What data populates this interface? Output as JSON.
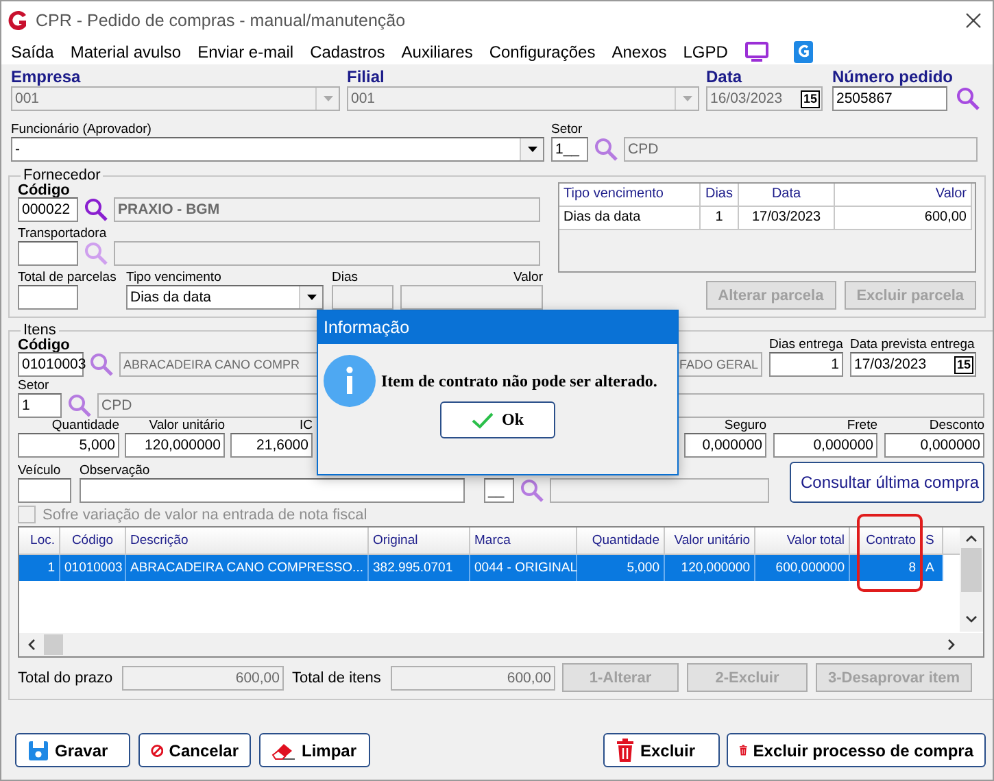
{
  "window": {
    "title": "CPR - Pedido de compras - manual/manutenção"
  },
  "menu": [
    {
      "label": "Saída"
    },
    {
      "label": "Material avulso"
    },
    {
      "label": "Enviar e-mail"
    },
    {
      "label": "Cadastros"
    },
    {
      "label": "Auxiliares"
    },
    {
      "label": "Configurações"
    },
    {
      "label": "Anexos"
    },
    {
      "label": "LGPD"
    }
  ],
  "header": {
    "empresa": {
      "label": "Empresa",
      "value": "001"
    },
    "filial": {
      "label": "Filial",
      "value": "001"
    },
    "data": {
      "label": "Data",
      "value": "16/03/2023",
      "calendar_day": "15"
    },
    "numero_pedido": {
      "label": "Número pedido",
      "value": "2505867"
    },
    "funcionario": {
      "label": "Funcionário (Aprovador)",
      "value": "-"
    },
    "setor": {
      "label": "Setor",
      "code": "1__",
      "name": "CPD"
    }
  },
  "fornecedor": {
    "title": "Fornecedor",
    "codigo_label": "Código",
    "codigo": "000022",
    "nome": "PRAXIO - BGM",
    "transportadora_label": "Transportadora",
    "total_parcelas_label": "Total de parcelas",
    "tipo_vencimento_label": "Tipo vencimento",
    "tipo_vencimento": "Dias da data",
    "dias_label": "Dias",
    "valor_label": "Valor",
    "parcelas": {
      "columns": [
        "Tipo vencimento",
        "Dias",
        "Data",
        "Valor"
      ],
      "rows": [
        [
          "Dias da data",
          "1",
          "17/03/2023",
          "600,00"
        ]
      ]
    },
    "buttons": [
      {
        "label": "Alterar parcela",
        "disabled": true
      },
      {
        "label": "Excluir parcela",
        "disabled": true
      }
    ]
  },
  "itens": {
    "title": "Itens",
    "codigo_label": "Código",
    "codigo": "01010003",
    "descricao_start": "ABRACADEIRA CANO COMPR",
    "descricao_end": "FADO GERAL",
    "dias_entrega_label": "Dias entrega",
    "dias_entrega": "1",
    "data_prevista_label": "Data prevista entrega",
    "data_prevista": "17/03/2023",
    "calendar_day": "15",
    "setor_label": "Setor",
    "setor": "1",
    "setor_nome": "CPD",
    "valores_left": [
      {
        "label": "Quantidade",
        "value": "5,000"
      },
      {
        "label": "Valor unitário",
        "value": "120,000000"
      },
      {
        "label": "IC",
        "value": "21,6000"
      }
    ],
    "valores_right": [
      {
        "label": "Seguro",
        "value": "0,000000"
      },
      {
        "label": "Frete",
        "value": "0,000000"
      },
      {
        "label": "Desconto",
        "value": "0,000000"
      }
    ],
    "veiculo_label": "Veículo",
    "observacao_label": "Observação",
    "mask_field": "__",
    "consultar_button": "Consultar última compra",
    "checkbox": {
      "label": "Sofre variação de valor na entrada de nota fiscal",
      "checked": false,
      "disabled": true
    },
    "table": {
      "columns": [
        "Loc.",
        "Código",
        "Descrição",
        "Original",
        "Marca",
        "Quantidade",
        "Valor unitário",
        "Valor total",
        "Contrato",
        "S"
      ],
      "rows": [
        {
          "selected": true,
          "cells": [
            "1",
            "01010003",
            "ABRACADEIRA CANO COMPRESSO...",
            "382.995.0701",
            "0044 - ORIGINAL",
            "5,000",
            "120,000000",
            "600,000000",
            "8",
            "A"
          ]
        }
      ]
    },
    "total_prazo_label": "Total do prazo",
    "total_prazo": "600,00",
    "total_itens_label": "Total de itens",
    "total_itens": "600,00",
    "buttons": [
      {
        "label": "1-Alterar",
        "disabled": true
      },
      {
        "label": "2-Excluir",
        "disabled": true
      },
      {
        "label": "3-Desaprovar item",
        "disabled": true
      }
    ]
  },
  "actions_left": [
    {
      "kind": "save",
      "label": "Gravar"
    },
    {
      "kind": "cancel",
      "label": "Cancelar"
    },
    {
      "kind": "eraser",
      "label": "Limpar"
    }
  ],
  "actions_right": [
    {
      "kind": "delete",
      "label": "Excluir"
    },
    {
      "kind": "delete",
      "label": "Excluir processo de compra"
    }
  ],
  "dialog": {
    "title": "Informação",
    "message": "Item de contrato não pode ser alterado.",
    "button": "Ok"
  }
}
